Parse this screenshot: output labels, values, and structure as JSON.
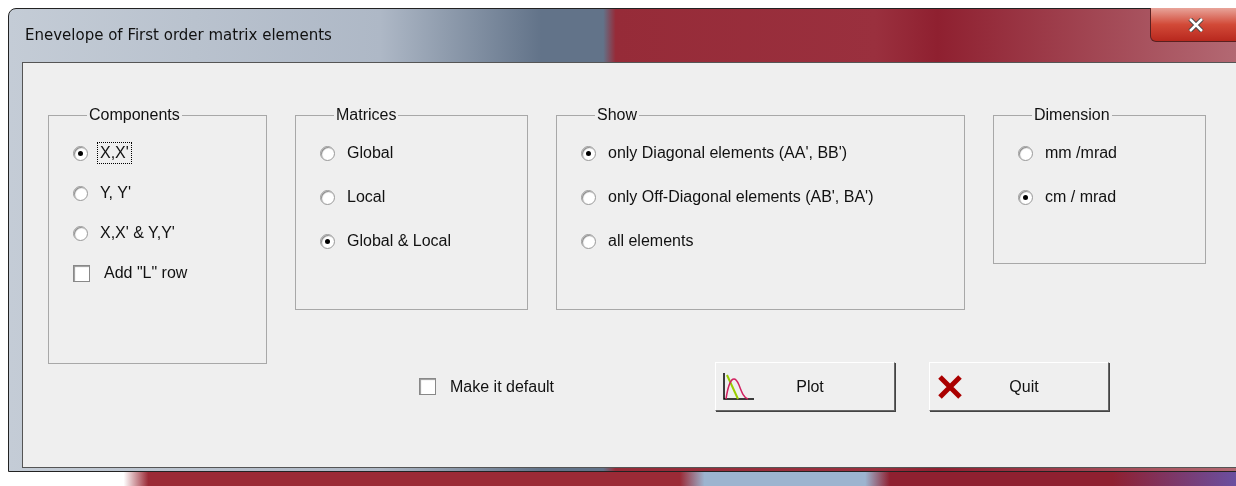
{
  "window": {
    "title": "Enevelope of First order matrix elements"
  },
  "groups": [
    {
      "title": "Components",
      "options": [
        {
          "kind": "radio",
          "label": "X,X'",
          "selected": true,
          "focused": true
        },
        {
          "kind": "radio",
          "label": "Y, Y'",
          "selected": false,
          "focused": false
        },
        {
          "kind": "radio",
          "label": "X,X' & Y,Y'",
          "selected": false,
          "focused": false
        },
        {
          "kind": "checkbox",
          "label": "Add \"L\" row",
          "checked": false,
          "focused": false
        }
      ]
    },
    {
      "title": "Matrices",
      "options": [
        {
          "kind": "radio",
          "label": "Global",
          "selected": false,
          "focused": false
        },
        {
          "kind": "radio",
          "label": "Local",
          "selected": false,
          "focused": false
        },
        {
          "kind": "radio",
          "label": "Global & Local",
          "selected": true,
          "focused": false
        }
      ]
    },
    {
      "title": "Show",
      "options": [
        {
          "kind": "radio",
          "label": "only Diagonal elements (AA', BB')",
          "selected": true,
          "focused": false
        },
        {
          "kind": "radio",
          "label": "only Off-Diagonal elements (AB', BA')",
          "selected": false,
          "focused": false
        },
        {
          "kind": "radio",
          "label": "all elements",
          "selected": false,
          "focused": false
        }
      ]
    },
    {
      "title": "Dimension",
      "options": [
        {
          "kind": "radio",
          "label": "mm /mrad",
          "selected": false,
          "focused": false
        },
        {
          "kind": "radio",
          "label": "cm / mrad",
          "selected": true,
          "focused": false
        }
      ]
    }
  ],
  "default_checkbox": {
    "label": "Make it default",
    "checked": false
  },
  "buttons": [
    {
      "kind": "plot",
      "label": "Plot"
    },
    {
      "kind": "quit",
      "label": "Quit"
    }
  ]
}
